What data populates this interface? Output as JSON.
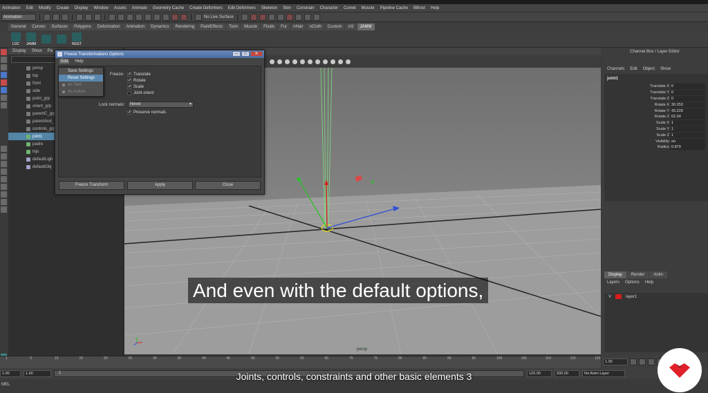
{
  "menubar": [
    "Animation",
    "Edit",
    "Modify",
    "Create",
    "Display",
    "Window",
    "Assets",
    "Animate",
    "Geometry Cache",
    "Create Deformers",
    "Edit Deformers",
    "Skeleton",
    "Skin",
    "Constrain",
    "Character",
    "Comet",
    "Muscle",
    "Pipeline Cache",
    "Bifrost",
    "Help"
  ],
  "status": {
    "mode": "Animation",
    "live_surface": "No Live Surface"
  },
  "shelf_tabs": [
    "General",
    "Curves",
    "Surfaces",
    "Polygons",
    "Deformation",
    "Animation",
    "Dynamics",
    "Rendering",
    "PaintEffects",
    "Toon",
    "Muscle",
    "Fluids",
    "Fur",
    "nHair",
    "nCloth",
    "Custom",
    "AS",
    "JAMM"
  ],
  "shelf_active": "JAMM",
  "shelf_items": [
    "LOC",
    "JAMM",
    "",
    "",
    "NGST"
  ],
  "outliner": {
    "menu": [
      "Display",
      "Show",
      "Pa"
    ],
    "items": [
      {
        "label": "persp",
        "icon": "camera",
        "selected": false
      },
      {
        "label": "top",
        "icon": "camera",
        "selected": false
      },
      {
        "label": "front",
        "icon": "camera",
        "selected": false
      },
      {
        "label": "side",
        "icon": "camera",
        "selected": false
      },
      {
        "label": "point_grp",
        "icon": "group",
        "selected": false
      },
      {
        "label": "orient_grp",
        "icon": "group",
        "selected": false
      },
      {
        "label": "parentC_grp",
        "icon": "group",
        "selected": false
      },
      {
        "label": "parentAnd_",
        "icon": "group",
        "selected": false
      },
      {
        "label": "controls_grp",
        "icon": "group",
        "selected": false
      },
      {
        "label": "joint1",
        "icon": "joint",
        "selected": true
      },
      {
        "label": "padre",
        "icon": "joint",
        "selected": false
      },
      {
        "label": "hijo",
        "icon": "joint",
        "selected": false
      },
      {
        "label": "defaultLigh",
        "icon": "set",
        "selected": false
      },
      {
        "label": "defaultObj",
        "icon": "set",
        "selected": false
      }
    ]
  },
  "viewport": {
    "camera_label": "persp"
  },
  "dialog": {
    "title": "Freeze Transformations Options",
    "menu": [
      "Edit",
      "Help"
    ],
    "edit_menu": [
      {
        "label": "Save Settings",
        "state": "normal"
      },
      {
        "label": "Reset Settings",
        "state": "highlight"
      },
      {
        "label": "As Tool",
        "state": "disabled"
      },
      {
        "label": "As Action",
        "state": "disabled"
      }
    ],
    "freeze_label": "Freeze:",
    "options": [
      {
        "label": "Translate",
        "checked": true
      },
      {
        "label": "Rotate",
        "checked": true
      },
      {
        "label": "Scale",
        "checked": true
      },
      {
        "label": "Joint orient",
        "checked": false
      }
    ],
    "lock_normals_label": "Lock normals:",
    "lock_normals_value": "Never",
    "preserve_normals": {
      "label": "Preserve normals",
      "checked": true
    },
    "buttons": [
      "Freeze Transform",
      "Apply",
      "Close"
    ]
  },
  "channel_box": {
    "title": "Channel Box / Layer Editor",
    "menu": [
      "Channels",
      "Edit",
      "Object",
      "Show"
    ],
    "node": "joint1",
    "attributes": [
      {
        "name": "Translate X",
        "value": "0"
      },
      {
        "name": "Translate Y",
        "value": "0"
      },
      {
        "name": "Translate Z",
        "value": "0"
      },
      {
        "name": "Rotate X",
        "value": "30.253"
      },
      {
        "name": "Rotate Y",
        "value": "43.229"
      },
      {
        "name": "Rotate Z",
        "value": "62.34"
      },
      {
        "name": "Scale X",
        "value": "1"
      },
      {
        "name": "Scale Y",
        "value": "1"
      },
      {
        "name": "Scale Z",
        "value": "1"
      },
      {
        "name": "Visibility",
        "value": "on"
      },
      {
        "name": "Radius",
        "value": "0.879"
      }
    ]
  },
  "layer_editor": {
    "tabs": [
      "Display",
      "Render",
      "Anim"
    ],
    "menu": [
      "Layers",
      "Options",
      "Help"
    ],
    "layer": {
      "v": "V",
      "name": "layer1",
      "color": "#d61d1d"
    }
  },
  "timeline": {
    "frames": [
      "1",
      "5",
      "10",
      "15",
      "20",
      "25",
      "30",
      "35",
      "40",
      "45",
      "50",
      "55",
      "60",
      "65",
      "70",
      "75",
      "80",
      "85",
      "90",
      "95",
      "100",
      "105",
      "110",
      "115",
      "120"
    ],
    "current": "1.00",
    "range_start": "1.00",
    "range_start2": "1.00",
    "range_slider_start": "1",
    "range_end": "120.00",
    "range_end2": "200.00",
    "anim_layer": "No Anim Layer",
    "command_label": "MEL"
  },
  "subtitle": "And even with the default options,",
  "caption": "Joints, controls, constraints and other basic elements 3",
  "colors": {
    "selection": "#5285a6",
    "layer": "#d61d1d",
    "brand": "#e0202a"
  }
}
